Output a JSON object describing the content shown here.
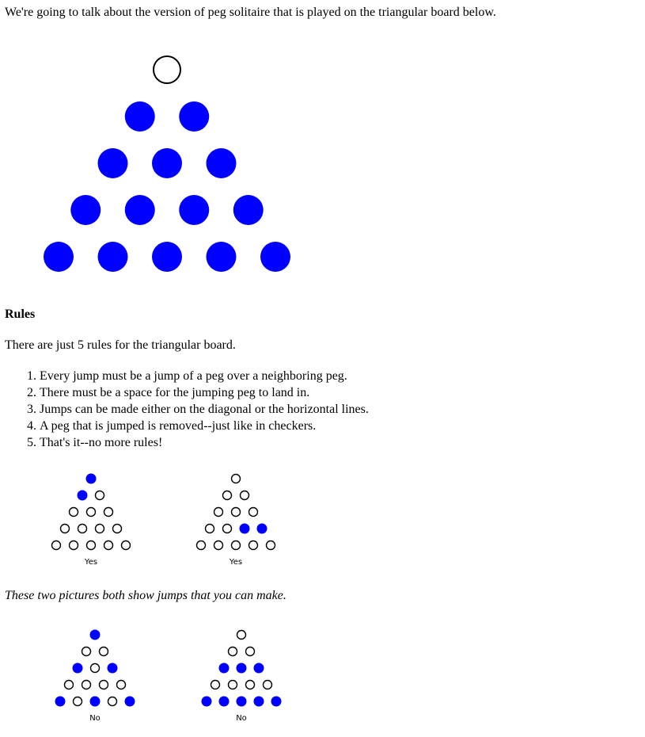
{
  "intro": "We're going to talk about the version of peg solitaire that is played on the triangular board below.",
  "rules_heading": "Rules",
  "rules_intro": "There are just 5 rules for the triangular board.",
  "rules": [
    "Every jump must be a jump of a peg over a neighboring peg.",
    "There must be a space for the jumping peg to land in.",
    "Jumps can be made either on the diagonal or the horizontal lines.",
    "A peg that is jumped is removed--just like in checkers.",
    "That's it--no more rules!"
  ],
  "caption": "These two pictures both show jumps that you can make.",
  "colors": {
    "peg": "#0000ff",
    "hole_outline": "#000000"
  },
  "main_board": {
    "rows": [
      [
        0
      ],
      [
        1,
        1
      ],
      [
        1,
        1,
        1
      ],
      [
        1,
        1,
        1,
        1
      ],
      [
        1,
        1,
        1,
        1,
        1
      ]
    ]
  },
  "example_boards": [
    {
      "label": "Yes",
      "rows": [
        [
          1
        ],
        [
          1,
          0
        ],
        [
          0,
          0,
          0
        ],
        [
          0,
          0,
          0,
          0
        ],
        [
          0,
          0,
          0,
          0,
          0
        ]
      ]
    },
    {
      "label": "Yes",
      "rows": [
        [
          0
        ],
        [
          0,
          0
        ],
        [
          0,
          0,
          0
        ],
        [
          0,
          0,
          1,
          1
        ],
        [
          0,
          0,
          0,
          0,
          0
        ]
      ]
    },
    {
      "label": "No",
      "rows": [
        [
          1
        ],
        [
          0,
          0
        ],
        [
          1,
          0,
          1
        ],
        [
          0,
          0,
          0,
          0
        ],
        [
          1,
          0,
          1,
          0,
          1
        ]
      ]
    },
    {
      "label": "No",
      "rows": [
        [
          0
        ],
        [
          0,
          0
        ],
        [
          1,
          1,
          1
        ],
        [
          0,
          0,
          0,
          0
        ],
        [
          1,
          1,
          1,
          1,
          1
        ]
      ]
    }
  ]
}
